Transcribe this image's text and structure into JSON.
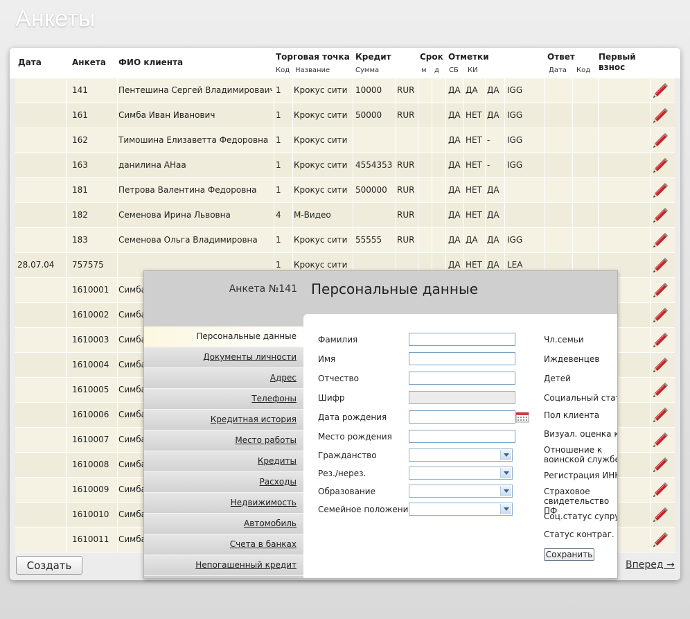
{
  "page_title": "Анкеты",
  "table": {
    "headers": {
      "date": "Дата",
      "anketa": "Анкета",
      "fio": "ФИО клиента",
      "store": "Торговая точка",
      "store_code": "Код",
      "store_name": "Название",
      "credit": "Кредит",
      "credit_sum": "Сумма",
      "term": "Срок",
      "term_m": "м",
      "term_d": "д",
      "marks": "Отметки",
      "marks_sb": "СБ",
      "marks_ki": "КИ",
      "answer": "Ответ",
      "answer_date": "Дата",
      "answer_code": "Код",
      "first_payment_1": "Первый",
      "first_payment_2": "взнос"
    },
    "rows": [
      {
        "date": "",
        "anketa": "141",
        "fio": "Пентешина  Сергей Владимироваич",
        "code": "1",
        "store": "Крокус сити",
        "sum": "10000",
        "cur": "RUR",
        "sb": "ДА",
        "ki": "ДА",
        "m3": "ДА",
        "m4": "IGG"
      },
      {
        "date": "",
        "anketa": "161",
        "fio": "Симба Иван Иванович",
        "code": "1",
        "store": "Крокус сити",
        "sum": "50000",
        "cur": "RUR",
        "sb": "ДА",
        "ki": "НЕТ",
        "m3": "ДА",
        "m4": "IGG"
      },
      {
        "date": "",
        "anketa": "162",
        "fio": "Тимошина Елизаветта Федоровна",
        "code": "1",
        "store": "Крокус сити",
        "sum": "",
        "cur": "",
        "sb": "ДА",
        "ki": "НЕТ",
        "m3": "-",
        "m4": "IGG"
      },
      {
        "date": "",
        "anketa": "163",
        "fio": "данилина АНаа",
        "code": "1",
        "store": "Крокус сити",
        "sum": "4554353",
        "cur": "RUR",
        "sb": "ДА",
        "ki": "НЕТ",
        "m3": "-",
        "m4": "IGG"
      },
      {
        "date": "",
        "anketa": "181",
        "fio": "Петрова Валентина Федоровна",
        "code": "1",
        "store": "Крокус сити",
        "sum": "500000",
        "cur": "RUR",
        "sb": "ДА",
        "ki": "НЕТ",
        "m3": "ДА",
        "m4": ""
      },
      {
        "date": "",
        "anketa": "182",
        "fio": "Семенова Ирина Львовна",
        "code": "4",
        "store": "М-Видео",
        "sum": "",
        "cur": "RUR",
        "sb": "ДА",
        "ki": "НЕТ",
        "m3": "ДА",
        "m4": ""
      },
      {
        "date": "",
        "anketa": "183",
        "fio": "Семенова Ольга Владимировна",
        "code": "1",
        "store": "Крокус сити",
        "sum": "55555",
        "cur": "RUR",
        "sb": "ДА",
        "ki": "ДА",
        "m3": "ДА",
        "m4": "IGG"
      },
      {
        "date": "28.07.04",
        "anketa": "757575",
        "fio": "",
        "code": "1",
        "store": "Крокус сити",
        "sum": "",
        "cur": "",
        "sb": "ДА",
        "ki": "НЕТ",
        "m3": "ДА",
        "m4": "LEA"
      },
      {
        "date": "",
        "anketa": "1610001",
        "fio": "Симба",
        "code": "",
        "store": "",
        "sum": "",
        "cur": "",
        "sb": "",
        "ki": "",
        "m3": "",
        "m4": ""
      },
      {
        "date": "",
        "anketa": "1610002",
        "fio": "Симба",
        "code": "",
        "store": "",
        "sum": "",
        "cur": "",
        "sb": "",
        "ki": "",
        "m3": "",
        "m4": ""
      },
      {
        "date": "",
        "anketa": "1610003",
        "fio": "Симба",
        "code": "",
        "store": "",
        "sum": "",
        "cur": "",
        "sb": "",
        "ki": "",
        "m3": "",
        "m4": ""
      },
      {
        "date": "",
        "anketa": "1610004",
        "fio": "Симба",
        "code": "",
        "store": "",
        "sum": "",
        "cur": "",
        "sb": "",
        "ki": "",
        "m3": "",
        "m4": ""
      },
      {
        "date": "",
        "anketa": "1610005",
        "fio": "Симба",
        "code": "",
        "store": "",
        "sum": "",
        "cur": "",
        "sb": "",
        "ki": "",
        "m3": "",
        "m4": ""
      },
      {
        "date": "",
        "anketa": "1610006",
        "fio": "Симба",
        "code": "",
        "store": "",
        "sum": "",
        "cur": "",
        "sb": "",
        "ki": "",
        "m3": "",
        "m4": ""
      },
      {
        "date": "",
        "anketa": "1610007",
        "fio": "Симба",
        "code": "",
        "store": "",
        "sum": "",
        "cur": "",
        "sb": "",
        "ki": "",
        "m3": "",
        "m4": ""
      },
      {
        "date": "",
        "anketa": "1610008",
        "fio": "Симба",
        "code": "",
        "store": "",
        "sum": "",
        "cur": "",
        "sb": "",
        "ki": "",
        "m3": "",
        "m4": ""
      },
      {
        "date": "",
        "anketa": "1610009",
        "fio": "Симба",
        "code": "",
        "store": "",
        "sum": "",
        "cur": "",
        "sb": "",
        "ki": "",
        "m3": "",
        "m4": ""
      },
      {
        "date": "",
        "anketa": "1610010",
        "fio": "Симба",
        "code": "",
        "store": "",
        "sum": "",
        "cur": "",
        "sb": "",
        "ki": "",
        "m3": "",
        "m4": ""
      },
      {
        "date": "",
        "anketa": "1610011",
        "fio": "Симба",
        "code": "",
        "store": "",
        "sum": "",
        "cur": "",
        "sb": "",
        "ki": "",
        "m3": "",
        "m4": ""
      }
    ],
    "row_action_icon": "pencil-edit-icon"
  },
  "footer": {
    "create_label": "Создать",
    "next_label": "Вперед →"
  },
  "dialog": {
    "anketa_number": "Анкета №141",
    "title": "Персональные данные",
    "menu": [
      "Персональные данные",
      "Документы личности",
      "Адрес",
      "Телефоны",
      "Кредитная история",
      "Место работы",
      "Кредиты",
      "Расходы",
      "Недвижимость",
      "Автомобиль",
      "Счета в банках",
      "Непогашенный кредит"
    ],
    "active_menu_index": 0,
    "fields": {
      "surname": {
        "label": "Фамилия",
        "value": ""
      },
      "name": {
        "label": "Имя",
        "value": ""
      },
      "patronymic": {
        "label": "Отчество",
        "value": ""
      },
      "cipher": {
        "label": "Шифр",
        "value": ""
      },
      "birth_date": {
        "label": "Дата рождения",
        "value": ""
      },
      "birth_place": {
        "label": "Место рождения",
        "value": ""
      },
      "citizenship": {
        "label": "Гражданство",
        "value": ""
      },
      "residency": {
        "label": "Рез./нерез.",
        "value": ""
      },
      "education": {
        "label": "Образование",
        "value": ""
      },
      "marital_status": {
        "label": "Семейное положение",
        "value": ""
      }
    },
    "right_labels": [
      "Чл.семьи",
      "Иждевенцев",
      "Детей",
      "Социальный статус",
      "Пол клиента",
      "Визуал. оценка клиента",
      "Отношение к воинской службе",
      "Регистрация ИНН",
      "Страховое свидетельство ПФ",
      "Соц.статус супруга",
      "Статус контраг."
    ],
    "save_label": "Сохранить",
    "calendar_icon": "calendar-icon",
    "dropdown_icon": "chevron-down-icon"
  },
  "colors": {
    "row_bg": "#f5f2e3",
    "row_bg_alt": "#efecdb",
    "active_menu_bg": "#fbf7e0",
    "pencil": "#c0262d"
  }
}
